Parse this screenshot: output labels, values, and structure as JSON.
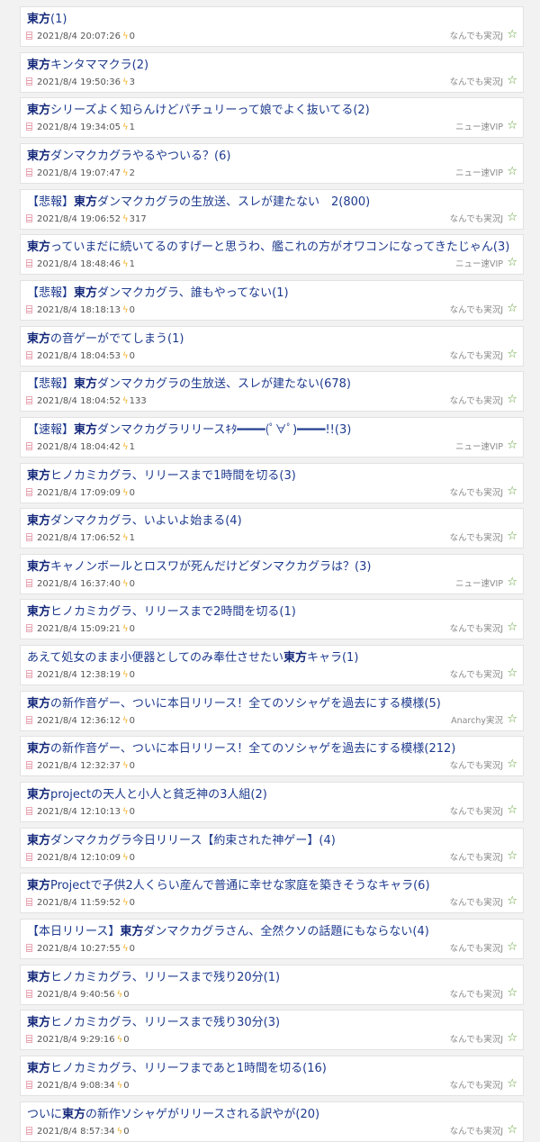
{
  "threads": [
    {
      "pre": "",
      "kw": "東方",
      "post": "(1)",
      "date": "2021/8/4 20:07:26",
      "count": "0",
      "board": "なんでも実況J"
    },
    {
      "pre": "",
      "kw": "東方",
      "post": "キンタママクラ(2)",
      "date": "2021/8/4 19:50:36",
      "count": "3",
      "board": "なんでも実況J"
    },
    {
      "pre": "",
      "kw": "東方",
      "post": "シリーズよく知らんけどパチュリーって娘でよく抜いてる(2)",
      "date": "2021/8/4 19:34:05",
      "count": "1",
      "board": "ニュー速VIP"
    },
    {
      "pre": "",
      "kw": "東方",
      "post": "ダンマクカグラやるやついる？(6)",
      "date": "2021/8/4 19:07:47",
      "count": "2",
      "board": "ニュー速VIP"
    },
    {
      "pre": "【悲報】",
      "kw": "東方",
      "post": "ダンマクカグラの生放送、スレが建たない　2(800)",
      "date": "2021/8/4 19:06:52",
      "count": "317",
      "board": "なんでも実況J"
    },
    {
      "pre": "",
      "kw": "東方",
      "post": "っていまだに続いてるのすげーと思うわ、艦これの方がオワコンになってきたじゃん(3)",
      "date": "2021/8/4 18:48:46",
      "count": "1",
      "board": "ニュー速VIP"
    },
    {
      "pre": "【悲報】",
      "kw": "東方",
      "post": "ダンマクカグラ、誰もやってない(1)",
      "date": "2021/8/4 18:18:13",
      "count": "0",
      "board": "なんでも実況J"
    },
    {
      "pre": "",
      "kw": "東方",
      "post": "の音ゲーがでてしまう(1)",
      "date": "2021/8/4 18:04:53",
      "count": "0",
      "board": "なんでも実況J"
    },
    {
      "pre": "【悲報】",
      "kw": "東方",
      "post": "ダンマクカグラの生放送、スレが建たない(678)",
      "date": "2021/8/4 18:04:52",
      "count": "133",
      "board": "なんでも実況J"
    },
    {
      "pre": "【速報】",
      "kw": "東方",
      "post": "ダンマクカグラリリースｷﾀ━━━━(ﾟ∀ﾟ)━━━━!!(3)",
      "date": "2021/8/4 18:04:42",
      "count": "1",
      "board": "ニュー速VIP"
    },
    {
      "pre": "",
      "kw": "東方",
      "post": "ヒノカミカグラ、リリースまで1時間を切る(3)",
      "date": "2021/8/4 17:09:09",
      "count": "0",
      "board": "なんでも実況J"
    },
    {
      "pre": "",
      "kw": "東方",
      "post": "ダンマクカグラ、いよいよ始まる(4)",
      "date": "2021/8/4 17:06:52",
      "count": "1",
      "board": "なんでも実況J"
    },
    {
      "pre": "",
      "kw": "東方",
      "post": "キャノンボールとロスワが死んだけどダンマクカグラは？(3)",
      "date": "2021/8/4 16:37:40",
      "count": "0",
      "board": "ニュー速VIP"
    },
    {
      "pre": "",
      "kw": "東方",
      "post": "ヒノカミカグラ、リリースまで2時間を切る(1)",
      "date": "2021/8/4 15:09:21",
      "count": "0",
      "board": "なんでも実況J"
    },
    {
      "pre": "あえて処女のまま小便器としてのみ奉仕させたい",
      "kw": "東方",
      "post": "キャラ(1)",
      "date": "2021/8/4 12:38:19",
      "count": "0",
      "board": "なんでも実況J"
    },
    {
      "pre": "",
      "kw": "東方",
      "post": "の新作音ゲー、ついに本日リリース！全てのソシャゲを過去にする模様(5)",
      "date": "2021/8/4 12:36:12",
      "count": "0",
      "board": "Anarchy実況"
    },
    {
      "pre": "",
      "kw": "東方",
      "post": "の新作音ゲー、ついに本日リリース！全てのソシャゲを過去にする模様(212)",
      "date": "2021/8/4 12:32:37",
      "count": "0",
      "board": "なんでも実況J"
    },
    {
      "pre": "",
      "kw": "東方",
      "post": "projectの天人と小人と貧乏神の3人組(2)",
      "date": "2021/8/4 12:10:13",
      "count": "0",
      "board": "なんでも実況J"
    },
    {
      "pre": "",
      "kw": "東方",
      "post": "ダンマクカグラ今日リリース【約束された神ゲー】(4)",
      "date": "2021/8/4 12:10:09",
      "count": "0",
      "board": "なんでも実況J"
    },
    {
      "pre": "",
      "kw": "東方",
      "post": "Projectで子供2人くらい産んで普通に幸せな家庭を築きそうなキャラ(6)",
      "date": "2021/8/4 11:59:52",
      "count": "0",
      "board": "なんでも実況J"
    },
    {
      "pre": "【本日リリース】",
      "kw": "東方",
      "post": "ダンマクカグラさん、全然クソの話題にもならない(4)",
      "date": "2021/8/4 10:27:55",
      "count": "0",
      "board": "なんでも実況J"
    },
    {
      "pre": "",
      "kw": "東方",
      "post": "ヒノカミカグラ、リリースまで残り20分(1)",
      "date": "2021/8/4 9:40:56",
      "count": "0",
      "board": "なんでも実況J"
    },
    {
      "pre": "",
      "kw": "東方",
      "post": "ヒノカミカグラ、リリースまで残り30分(3)",
      "date": "2021/8/4 9:29:16",
      "count": "0",
      "board": "なんでも実況J"
    },
    {
      "pre": "",
      "kw": "東方",
      "post": "ヒノカミカグラ、リリーフまであと1時間を切る(16)",
      "date": "2021/8/4 9:08:34",
      "count": "0",
      "board": "なんでも実況J"
    },
    {
      "pre": "ついに",
      "kw": "東方",
      "post": "の新作ソシャゲがリリースされる訳やが(20)",
      "date": "2021/8/4 8:57:34",
      "count": "0",
      "board": "なんでも実況J"
    }
  ],
  "icons": {
    "memo": "memo-icon",
    "bolt": "lightning-icon",
    "star": "favorite-star-icon"
  },
  "colors": {
    "title": "#1d3a8e",
    "keyword": "#14287a",
    "bolt": "#f3b22a",
    "star": "#5a9e2e"
  }
}
